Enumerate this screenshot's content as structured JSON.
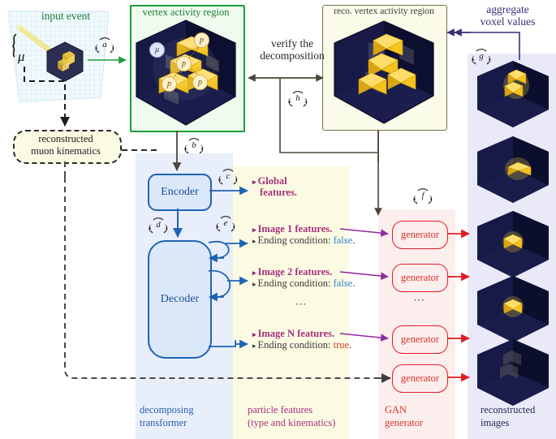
{
  "figure": {
    "domain": "pipeline-diagram",
    "labels": {
      "input_event": "input event",
      "muon_symbol": "μ",
      "vertex_activity_region": "vertex activity region",
      "reco_vertex_activity_region": "reco. vertex activity region",
      "verify_the_decomposition": "verify the\ndecomposition",
      "aggregate_voxel_values": "aggregate\nvoxel values",
      "reconstructed_muon_kinematics": "reconstructed\nmuon kinematics",
      "encoder": "Encoder",
      "decoder": "Decoder",
      "generator": "generator",
      "ellipsis": "⋯"
    },
    "tags": {
      "a": "a",
      "b": "b",
      "c": "c",
      "d": "d",
      "e": "e",
      "f": "f",
      "g": "g",
      "h": "h"
    },
    "vertex_particles": [
      {
        "symbol": "μ",
        "kind": "muon",
        "color": "#dde6f7"
      },
      {
        "symbol": "p",
        "kind": "proton",
        "color": "#fdf0c8"
      },
      {
        "symbol": "p",
        "kind": "proton",
        "color": "#fdf0c8"
      },
      {
        "symbol": "p",
        "kind": "proton",
        "color": "#fdf0c8"
      },
      {
        "symbol": "p",
        "kind": "proton",
        "color": "#fdf0c8"
      }
    ],
    "features": {
      "global": {
        "main": "Global",
        "main2": "features.",
        "bullet": "▸"
      },
      "items": [
        {
          "main": "Image 1 features.",
          "sub_label": "Ending condition:",
          "sub_value": "false",
          "sub_end": ".",
          "value_state": "false"
        },
        {
          "main": "Image 2 features.",
          "sub_label": "Ending condition:",
          "sub_value": "false",
          "sub_end": ".",
          "value_state": "false"
        },
        {
          "main": "Image N features.",
          "sub_label": "Ending condition:",
          "sub_value": "true",
          "sub_end": ".",
          "value_state": "true"
        }
      ],
      "ellipsis": "⋯"
    },
    "generators": [
      "generator",
      "generator",
      "generator",
      "generator"
    ],
    "captions": {
      "transformer_l1": "decomposing",
      "transformer_l2": "transformer",
      "features_l1": "particle features",
      "features_l2": "(type and kinematics)",
      "gan_l1": "GAN",
      "gan_l2": "generator",
      "images_l1": "reconstructed",
      "images_l2": "images"
    },
    "colors": {
      "green_border": "#1a9e3a",
      "green_text": "#1a7a33",
      "panel_transformer": "#e8eefa",
      "panel_features": "#fbfbe3",
      "panel_gan": "#fdeeee",
      "panel_images": "#e9e9f8",
      "blue_box_stroke": "#1f63b5",
      "blue_box_fill": "#dbe8f9",
      "red_stroke": "#e01b24",
      "red_fill": "#fdeeee",
      "magenta_text": "#a8307c",
      "purple_arrow": "#3c2d77",
      "dark_olive_arrow": "#5a5238",
      "false_blue": "#2f7fd0",
      "true_red": "#e03b20",
      "voxel_yellow": "#f5c518",
      "voxel_dark": "#15163a"
    },
    "reconstructed_images_count": 5
  }
}
